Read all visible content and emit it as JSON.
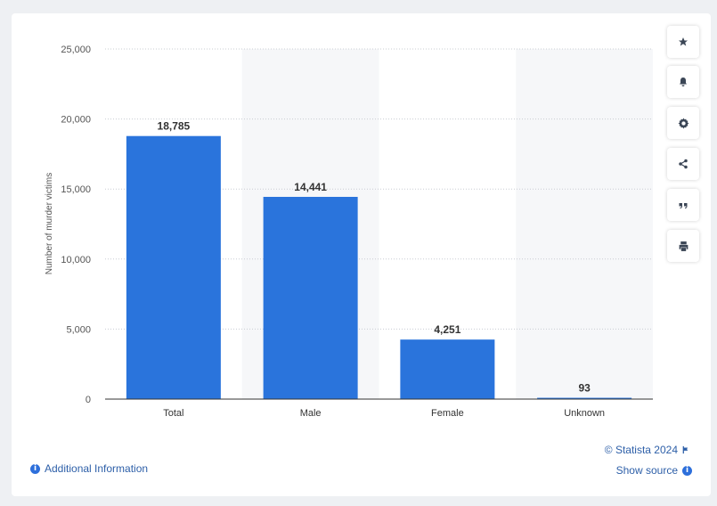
{
  "chart_data": {
    "type": "bar",
    "categories": [
      "Total",
      "Male",
      "Female",
      "Unknown"
    ],
    "values": [
      18785,
      14441,
      4251,
      93
    ],
    "value_labels": [
      "18,785",
      "14,441",
      "4,251",
      "93"
    ],
    "ylabel": "Number of murder victims",
    "xlabel": "",
    "ylim": [
      0,
      25000
    ],
    "yticks": [
      0,
      5000,
      10000,
      15000,
      20000,
      25000
    ],
    "ytick_labels": [
      "0",
      "5,000",
      "10,000",
      "15,000",
      "20,000",
      "25,000"
    ],
    "grid": true,
    "bar_color": "#2a74dc"
  },
  "toolbar": {
    "icons": [
      "star-icon",
      "bell-icon",
      "gear-icon",
      "share-icon",
      "quote-icon",
      "print-icon"
    ]
  },
  "footer": {
    "credit": "© Statista 2024",
    "show_source": "Show source",
    "additional_info": "Additional Information"
  }
}
